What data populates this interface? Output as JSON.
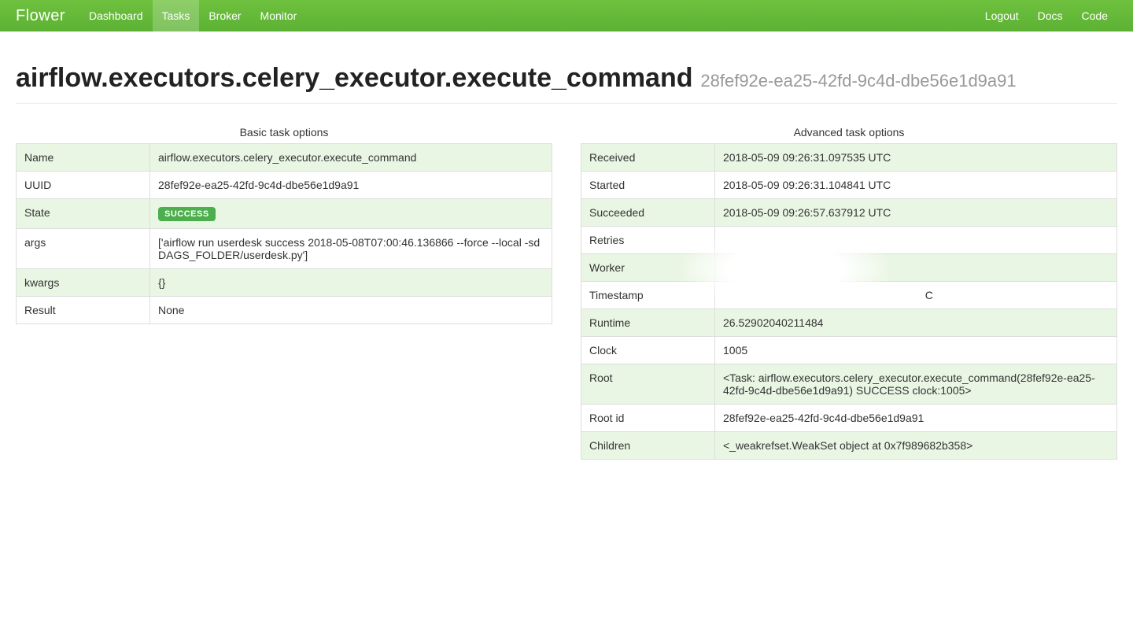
{
  "brand": "Flower",
  "nav": {
    "left": [
      "Dashboard",
      "Tasks",
      "Broker",
      "Monitor"
    ],
    "right": [
      "Logout",
      "Docs",
      "Code"
    ],
    "activeIndex": 1
  },
  "header": {
    "title": "airflow.executors.celery_executor.execute_command",
    "subtitle": "28fef92e-ea25-42fd-9c4d-dbe56e1d9a91"
  },
  "basic": {
    "caption": "Basic task options",
    "rows": [
      {
        "k": "Name",
        "v": "airflow.executors.celery_executor.execute_command"
      },
      {
        "k": "UUID",
        "v": "28fef92e-ea25-42fd-9c4d-dbe56e1d9a91"
      },
      {
        "k": "State",
        "v": "SUCCESS",
        "badge": true
      },
      {
        "k": "args",
        "v": "['airflow run userdesk success 2018-05-08T07:00:46.136866 --force --local -sd DAGS_FOLDER/userdesk.py']"
      },
      {
        "k": "kwargs",
        "v": "{}"
      },
      {
        "k": "Result",
        "v": "None"
      }
    ]
  },
  "advanced": {
    "caption": "Advanced task options",
    "rows": [
      {
        "k": "Received",
        "v": "2018-05-09 09:26:31.097535 UTC"
      },
      {
        "k": "Started",
        "v": "2018-05-09 09:26:31.104841 UTC"
      },
      {
        "k": "Succeeded",
        "v": "2018-05-09 09:26:57.637912 UTC"
      },
      {
        "k": "Retries",
        "v": ""
      },
      {
        "k": "Worker",
        "v": ""
      },
      {
        "k": "Timestamp",
        "v": "                                                                  C"
      },
      {
        "k": "Runtime",
        "v": "26.52902040211484"
      },
      {
        "k": "Clock",
        "v": "1005"
      },
      {
        "k": "Root",
        "v": "<Task: airflow.executors.celery_executor.execute_command(28fef92e-ea25-42fd-9c4d-dbe56e1d9a91) SUCCESS clock:1005>"
      },
      {
        "k": "Root id",
        "v": "28fef92e-ea25-42fd-9c4d-dbe56e1d9a91"
      },
      {
        "k": "Children",
        "v": "<_weakrefset.WeakSet object at 0x7f989682b358>"
      }
    ]
  }
}
